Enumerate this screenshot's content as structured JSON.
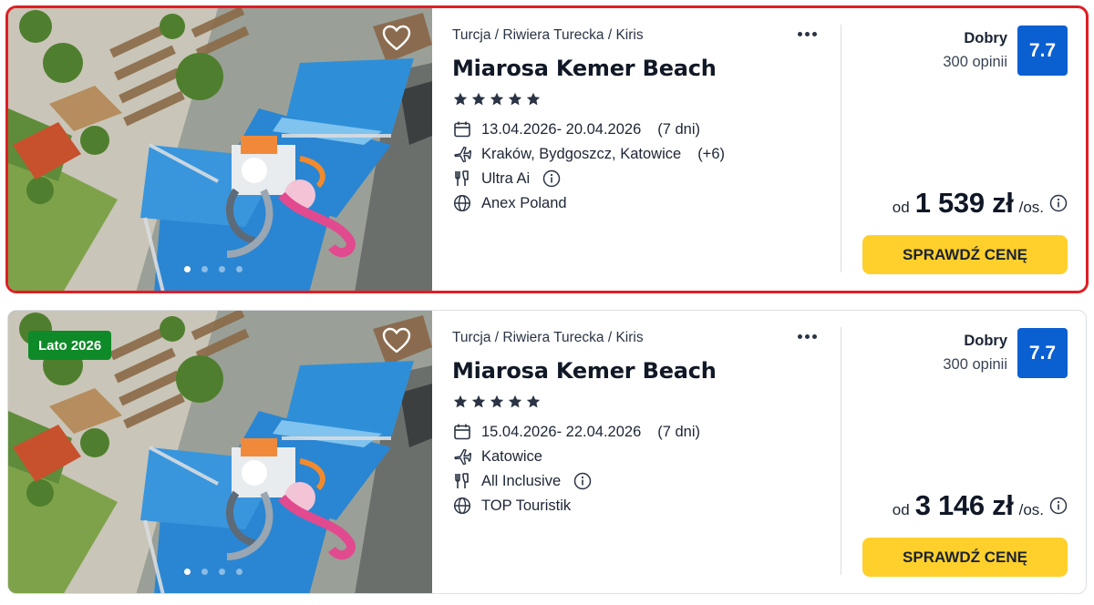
{
  "offers": [
    {
      "badge": "",
      "location": "Turcja / Riwiera Turecka / Kiris",
      "hotel_name": "Miarosa Kemer Beach",
      "stars": 5,
      "dates": "13.04.2026- 20.04.2026",
      "duration": "(7 dni)",
      "departure": "Kraków, Bydgoszcz, Katowice",
      "departure_more": "(+6)",
      "board": "Ultra Ai",
      "operator": "Anex Poland",
      "rating_label": "Dobry",
      "reviews": "300 opinii",
      "score": "7.7",
      "price_prefix": "od",
      "price": "1 539 zł",
      "price_unit": "/os.",
      "cta_label": "SPRAWDŹ CENĘ",
      "gallery_active_index": 0,
      "gallery_dots": 4,
      "selected": true
    },
    {
      "badge": "Lato 2026",
      "location": "Turcja / Riwiera Turecka / Kiris",
      "hotel_name": "Miarosa Kemer Beach",
      "stars": 5,
      "dates": "15.04.2026- 22.04.2026",
      "duration": "(7 dni)",
      "departure": "Katowice",
      "departure_more": "",
      "board": "All Inclusive",
      "operator": "TOP Touristik",
      "rating_label": "Dobry",
      "reviews": "300 opinii",
      "score": "7.7",
      "price_prefix": "od",
      "price": "3 146 zł",
      "price_unit": "/os.",
      "cta_label": "SPRAWDŹ CENĘ",
      "gallery_active_index": 0,
      "gallery_dots": 4,
      "selected": false
    }
  ],
  "colors": {
    "score_bg": "#0a5fd1",
    "cta_bg": "#ffd02b",
    "badge_bg": "#0f8a28",
    "selection_outline": "#e01e25"
  },
  "icons": {
    "favorite": "heart-outline-icon",
    "menu": "more-dots-icon",
    "dates": "calendar-icon",
    "departure": "plane-icon",
    "board": "fork-knife-icon",
    "operator": "globe-icon",
    "info": "info-circle-icon",
    "star": "star-icon"
  }
}
